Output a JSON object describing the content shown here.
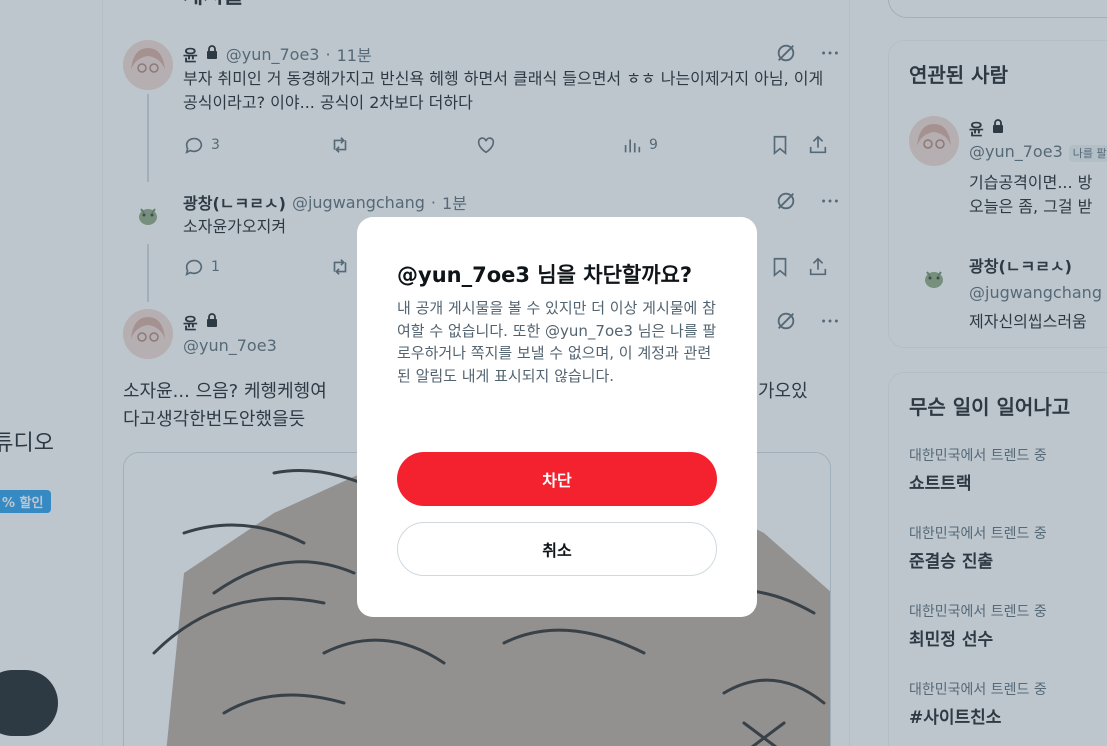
{
  "leftnav": {
    "studio_label": "튜디오",
    "badge_label": "% 할인"
  },
  "main": {
    "title_partial": "게시물",
    "tweets": [
      {
        "name": "윤",
        "handle": "@yun_7oe3",
        "time": "11분",
        "body": "부자 취미인 거 동경해가지고 반신욕 헤헹 하면서 클래식 들으면서 ㅎㅎ 나는이제거지 아님, 이게 공식이라고? 이야... 공식이 2차보다 더하다",
        "replies": "3",
        "views": "9"
      },
      {
        "name": "광창(ㄴㅋㄹㅅ)",
        "handle": "@jugwangchang",
        "time": "1분",
        "body": "소자윤가오지켜",
        "replies": "1"
      },
      {
        "name": "윤",
        "handle": "@yun_7oe3",
        "body": "소자윤... 으음? 케헹케헹여우... 가오있다고생각한번도안했을듯",
        "body_line1": "소자윤... 으음? 케헹케헹여",
        "body_line1_end": "가오있",
        "body_line2": "다고생각한번도안했을듯"
      }
    ],
    "separator": "·"
  },
  "right": {
    "related_title": "연관된 사람",
    "related": [
      {
        "name": "윤",
        "handle": "@yun_7oe3",
        "follows_you": "나를 팔",
        "bio_line1": "기습공격이면... 방",
        "bio_line2": "오늘은 좀, 그걸 받"
      },
      {
        "name": "광창(ㄴㅋㄹㅅ)",
        "handle": "@jugwangchang",
        "bio_line1": "제자신의씹스러움"
      }
    ],
    "trends_title": "무슨 일이 일어나고",
    "trends": [
      {
        "context": "대한민국에서 트렌드 중",
        "name": "쇼트트랙"
      },
      {
        "context": "대한민국에서 트렌드 중",
        "name": "준결승 진출"
      },
      {
        "context": "대한민국에서 트렌드 중",
        "name": "최민정 선수"
      },
      {
        "context": "대한민국에서 트렌드 중",
        "name": "#사이트친소"
      }
    ]
  },
  "dialog": {
    "title": "@yun_7oe3 님을 차단할까요?",
    "description": "내 공개 게시물을 볼 수 있지만 더 이상 게시물에 참여할 수 없습니다. 또한 @yun_7oe3 님은 나를 팔로우하거나 쪽지를 보낼 수 없으며, 이 계정과 관련된 알림도 내게 표시되지 않습니다.",
    "block_label": "차단",
    "cancel_label": "취소"
  },
  "colors": {
    "block_red": "#f4212e",
    "text_primary": "#0f1419",
    "text_secondary": "#536471",
    "overlay": "rgba(91,112,131,0.4)"
  },
  "icons": [
    "lock-icon",
    "grok-icon",
    "more-icon",
    "reply-icon",
    "repost-icon",
    "like-icon",
    "views-icon",
    "bookmark-icon",
    "share-icon"
  ]
}
